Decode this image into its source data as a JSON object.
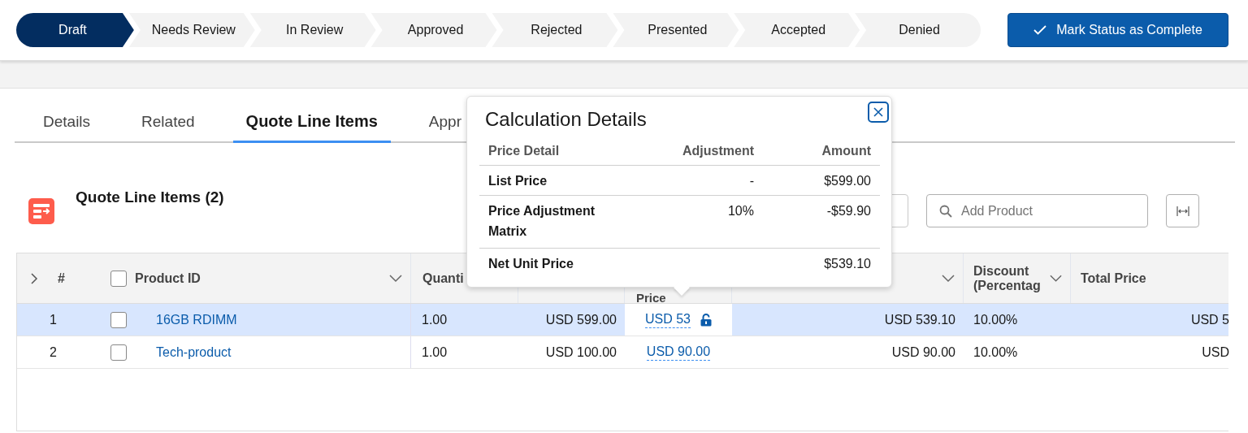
{
  "path": {
    "stages": [
      {
        "label": "Draft",
        "selected": true
      },
      {
        "label": "Needs Review",
        "selected": false
      },
      {
        "label": "In Review",
        "selected": false
      },
      {
        "label": "Approved",
        "selected": false
      },
      {
        "label": "Rejected",
        "selected": false
      },
      {
        "label": "Presented",
        "selected": false
      },
      {
        "label": "Accepted",
        "selected": false
      },
      {
        "label": "Denied",
        "selected": false
      }
    ],
    "complete_button": "Mark Status as Complete"
  },
  "tabs": [
    {
      "label": "Details",
      "selected": false
    },
    {
      "label": "Related",
      "selected": false
    },
    {
      "label": "Quote Line Items",
      "selected": true
    },
    {
      "label": "Appr",
      "selected": false
    }
  ],
  "list": {
    "title": "Quote Line Items (2)",
    "search": {
      "placeholder": "Add Product"
    }
  },
  "table": {
    "header_checked": false,
    "columns": [
      {
        "kind": "number",
        "label": "#"
      },
      {
        "kind": "product",
        "label": "Product ID",
        "sortable": true
      },
      {
        "kind": "text",
        "label": "Quanti"
      },
      {
        "kind": "money"
      },
      {
        "kind": "net",
        "label": "Price"
      },
      {
        "kind": "money",
        "sortable": true
      },
      {
        "kind": "text",
        "label": "Discount (Percentag",
        "sortable": true
      },
      {
        "kind": "total",
        "label": "Total Price"
      }
    ],
    "rows": [
      {
        "selected": true,
        "checked": false,
        "locked": true,
        "cells": [
          "1",
          "16GB RDIMM",
          "1.00",
          "USD 599.00",
          "USD 53",
          "USD 539.10",
          "10.00%",
          "USD 5"
        ]
      },
      {
        "selected": false,
        "checked": false,
        "locked": false,
        "cells": [
          "2",
          "Tech-product",
          "1.00",
          "USD 100.00",
          "USD 90.00",
          "USD 90.00",
          "10.00%",
          "USD"
        ]
      }
    ]
  },
  "popover": {
    "title": "Calculation Details",
    "columns": [
      "Price Detail",
      "Adjustment",
      "Amount"
    ],
    "rows": [
      {
        "detail": "List Price",
        "adjustment": "-",
        "amount": "$599.00"
      },
      {
        "detail": "Price Adjustment Matrix",
        "adjustment": "10%",
        "amount": "-$59.90"
      },
      {
        "detail": "Net Unit Price",
        "amount": "$539.10"
      }
    ]
  }
}
